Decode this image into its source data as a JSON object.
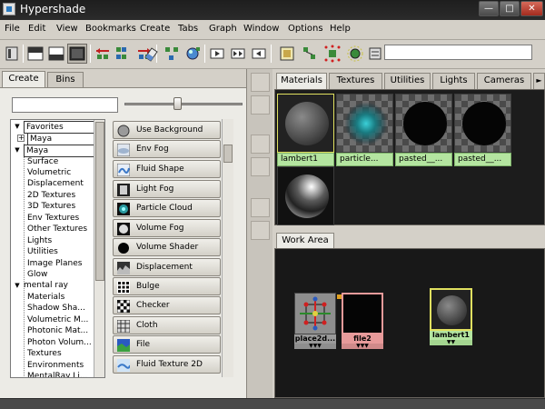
{
  "window": {
    "title": "Hypershade"
  },
  "menu": [
    "File",
    "Edit",
    "View",
    "Bookmarks",
    "Create",
    "Tabs",
    "Graph",
    "Window",
    "Options",
    "Help"
  ],
  "left_tabs": [
    "Create",
    "Bins"
  ],
  "tree": [
    {
      "label": "Favorites",
      "toggle": "▼",
      "selected": true
    },
    {
      "label": "Maya",
      "toggle": "+",
      "selected": true
    },
    {
      "label": "Maya",
      "toggle": "▼",
      "selected": true
    },
    {
      "label": "Surface"
    },
    {
      "label": "Volumetric"
    },
    {
      "label": "Displacement"
    },
    {
      "label": "2D Textures"
    },
    {
      "label": "3D Textures"
    },
    {
      "label": "Env Textures"
    },
    {
      "label": "Other Textures"
    },
    {
      "label": "Lights"
    },
    {
      "label": "Utilities"
    },
    {
      "label": "Image Planes"
    },
    {
      "label": "Glow"
    },
    {
      "label": "mental ray",
      "toggle": "▼"
    },
    {
      "label": "Materials"
    },
    {
      "label": "Shadow Sha..."
    },
    {
      "label": "Volumetric M..."
    },
    {
      "label": "Photonic Mat..."
    },
    {
      "label": "Photon Volum..."
    },
    {
      "label": "Textures"
    },
    {
      "label": "Environments"
    },
    {
      "label": "MentalRay Li..."
    }
  ],
  "node_buttons": [
    {
      "label": "Use Background",
      "icon": "use-background-icon"
    },
    {
      "label": "Env Fog",
      "icon": "env-fog-icon"
    },
    {
      "label": "Fluid Shape",
      "icon": "fluid-shape-icon"
    },
    {
      "label": "Light Fog",
      "icon": "light-fog-icon"
    },
    {
      "label": "Particle Cloud",
      "icon": "particle-cloud-icon"
    },
    {
      "label": "Volume Fog",
      "icon": "volume-fog-icon"
    },
    {
      "label": "Volume Shader",
      "icon": "volume-shader-icon"
    },
    {
      "label": "Displacement",
      "icon": "displacement-icon"
    },
    {
      "label": "Bulge",
      "icon": "bulge-icon"
    },
    {
      "label": "Checker",
      "icon": "checker-icon"
    },
    {
      "label": "Cloth",
      "icon": "cloth-icon"
    },
    {
      "label": "File",
      "icon": "file-icon"
    },
    {
      "label": "Fluid Texture 2D",
      "icon": "fluid-texture-2d-icon"
    }
  ],
  "right_tabs": [
    "Materials",
    "Textures",
    "Utilities",
    "Lights",
    "Cameras"
  ],
  "materials": [
    {
      "label": "lambert1",
      "preview": "gray-sphere"
    },
    {
      "label": "particle...",
      "preview": "particle-cloud"
    },
    {
      "label": "pasted__...",
      "preview": "black-sphere-checker"
    },
    {
      "label": "pasted__...",
      "preview": "black-sphere-checker"
    },
    {
      "label": "",
      "preview": "chrome-sphere"
    }
  ],
  "work_area": {
    "tab": "Work Area",
    "nodes": [
      {
        "label": "place2d...",
        "kind": "place2d"
      },
      {
        "label": "file2",
        "kind": "file"
      },
      {
        "label": "lambert1",
        "kind": "lambert"
      }
    ]
  },
  "colors": {
    "material_caption": "#b4e5a0",
    "file_node": "#e79a9a",
    "place_node": "#8e8e8e",
    "lambert_node": "#b4e5a0",
    "selection_outline": "#e0e060"
  }
}
